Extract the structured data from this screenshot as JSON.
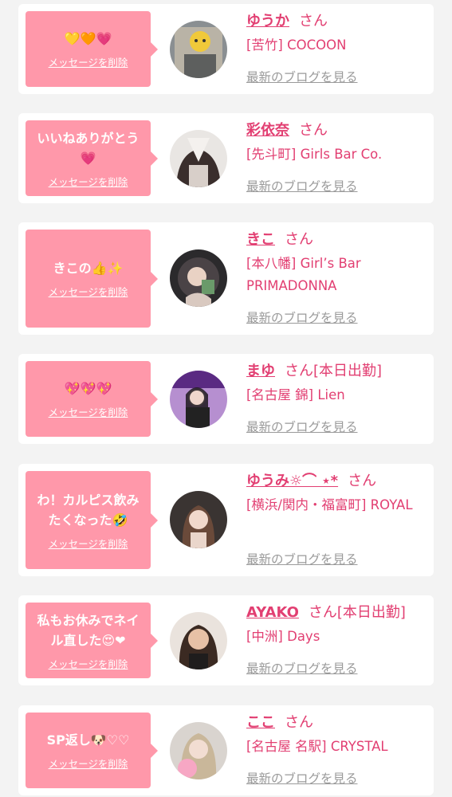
{
  "delete_label": "メッセージを削除",
  "blog_label": "最新のブログを見る",
  "honorific": "さん",
  "colors": {
    "accent": "#e23f72",
    "bubble": "#ff98aa",
    "card": "#ffffff",
    "background": "#f3f3f3",
    "link_gray": "#9a9a9a"
  },
  "items": [
    {
      "message": "💛🧡💗",
      "name": "ゆうか",
      "badge": "",
      "shop": "[苦竹] COCOON",
      "avatar_icon": "girl-avatar-icon"
    },
    {
      "message": "いいねありがとう💗",
      "name": "彩依奈",
      "badge": "",
      "shop": "[先斗町] Girls Bar Co.",
      "avatar_icon": "girl-avatar-icon"
    },
    {
      "message": "きこの👍✨",
      "name": "きこ",
      "badge": "",
      "shop": "[本八幡] Girl’s Bar PRIMADONNA",
      "avatar_icon": "girl-avatar-icon"
    },
    {
      "message": "💖💖💖",
      "name": "まゆ",
      "badge": "[本日出勤]",
      "shop": "[名古屋 錦] Lien",
      "avatar_icon": "girl-avatar-icon"
    },
    {
      "message": "わ！カルピス飲みたくなった🤣",
      "name": "ゆうみ☼⌒ ⋆*",
      "badge": "",
      "shop": "[横浜/関内・福富町] ROYAL",
      "avatar_icon": "girl-avatar-icon"
    },
    {
      "message": "私もお休みでネイル直した😍❤",
      "name": "AYAKO",
      "badge": "[本日出勤]",
      "shop": "[中洲] Days",
      "avatar_icon": "girl-avatar-icon"
    },
    {
      "message": "SP返し🐶♡♡",
      "name": "ここ",
      "badge": "",
      "shop": "[名古屋 名駅] CRYSTAL",
      "avatar_icon": "girl-avatar-icon"
    }
  ]
}
